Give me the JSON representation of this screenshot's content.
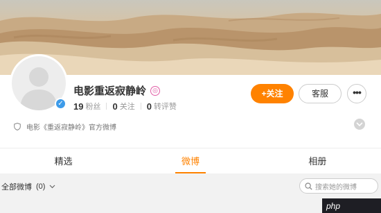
{
  "profile": {
    "name": "电影重返寂静岭",
    "name_badge": "◎",
    "verified_glyph": "✓",
    "stats": [
      {
        "value": "19",
        "label": "粉丝"
      },
      {
        "value": "0",
        "label": "关注"
      },
      {
        "value": "0",
        "label": "转评赞"
      }
    ],
    "description": "电影《重返寂静岭》官方微博"
  },
  "actions": {
    "follow_label": "+关注",
    "service_label": "客服",
    "more_label": "•••"
  },
  "tabs": [
    {
      "label": "精选",
      "active": false
    },
    {
      "label": "微博",
      "active": true
    },
    {
      "label": "相册",
      "active": false
    }
  ],
  "filter": {
    "label": "全部微博",
    "count": "(0)"
  },
  "search": {
    "placeholder": "搜索她的微博"
  },
  "watermark": {
    "text": "php"
  },
  "colors": {
    "accent": "#ff8200",
    "verified": "#3d9be9"
  }
}
